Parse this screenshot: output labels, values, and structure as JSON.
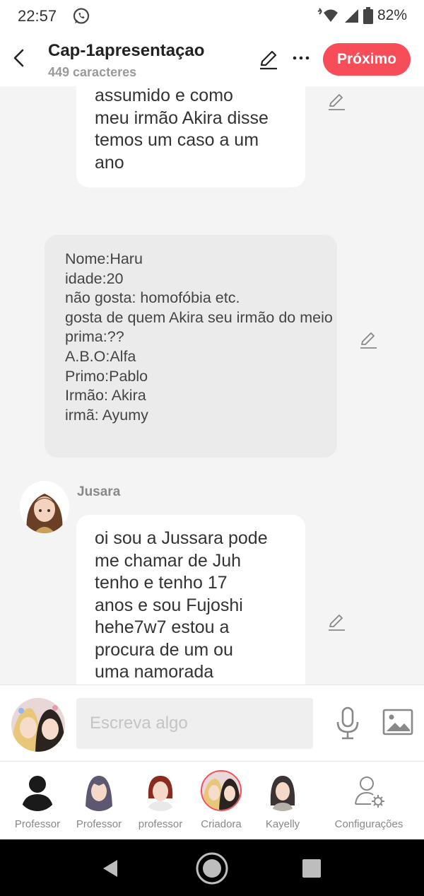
{
  "status_bar": {
    "time": "22:57",
    "battery": "82%",
    "icons": [
      "whatsapp-icon",
      "wifi-icon",
      "signal-icon",
      "battery-icon"
    ]
  },
  "header": {
    "title": "Cap-1apresentaçao",
    "subtitle": "449 caracteres",
    "next_label": "Próximo",
    "accent_color": "#f74d58"
  },
  "messages": [
    {
      "type": "bubble",
      "lines": [
        "assumido e como",
        "meu irmão Akira disse",
        "temos um caso a um",
        "ano"
      ]
    },
    {
      "type": "narration",
      "text": "Nome:Haru\nidade:20\nnão gosta: homofóbia etc.\ngosta de quem Akira seu irmão do meio\nprima:??\nA.B.O:Alfa\nPrimo:Pablo\nIrmão: Akira\nirmã: Ayumy"
    },
    {
      "type": "bubble",
      "speaker": "Jusara",
      "lines": [
        "oi sou a Jussara pode",
        "me chamar de Juh",
        "tenho e tenho 17",
        "anos e sou Fujoshi",
        "hehe7w7 estou a",
        "procura de um ou",
        "uma namorada"
      ]
    }
  ],
  "input": {
    "placeholder": "Escreva algo"
  },
  "characters": [
    {
      "label": "Professor"
    },
    {
      "label": "Professor"
    },
    {
      "label": "professor"
    },
    {
      "label": "Criadora",
      "active": true
    },
    {
      "label": "Kayelly"
    },
    {
      "label": "Configurações",
      "icon": "user-settings-icon"
    }
  ]
}
